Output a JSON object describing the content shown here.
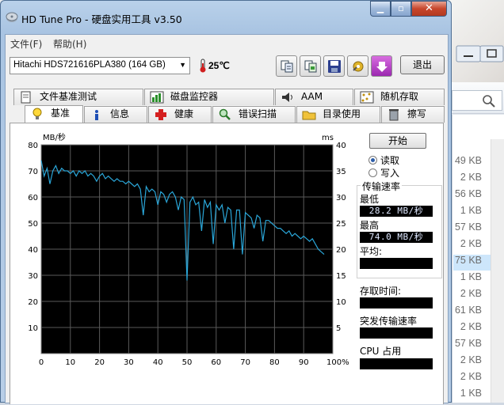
{
  "window": {
    "title": "HD Tune Pro - 硬盘实用工具 v3.50",
    "caption_buttons": [
      "minimize-icon",
      "maximize-icon",
      "close-icon"
    ]
  },
  "menu": {
    "file": "文件(F)",
    "help": "帮助(H)"
  },
  "toolbar": {
    "drive": "Hitachi HDS721616PLA380 (164 GB)",
    "temperature": "25℃",
    "exit_label": "退出",
    "icons": [
      "copy-text-icon",
      "copy-screenshot-icon",
      "save-icon",
      "options-icon",
      "download-icon"
    ]
  },
  "tabs_top": [
    "文件基准测试",
    "磁盘监控器",
    "AAM",
    "随机存取"
  ],
  "tabs_bottom": [
    "基准",
    "信息",
    "健康",
    "错误扫描",
    "目录使用",
    "擦写"
  ],
  "controls": {
    "start_label": "开始",
    "read_label": "读取",
    "write_label": "写入",
    "read_selected": true
  },
  "results": {
    "transfer_rate_title": "传输速率",
    "min_label": "最低",
    "min_value": "28.2 MB/秒",
    "max_label": "最高",
    "max_value": "74.0 MB/秒",
    "avg_label": "平均:",
    "avg_value": "",
    "access_label": "存取时间:",
    "access_value": "",
    "burst_label": "突发传输速率",
    "burst_value": "",
    "cpu_label": "CPU 占用",
    "cpu_value": ""
  },
  "background": {
    "file_sizes": [
      "49 KB",
      "2 KB",
      "56 KB",
      "1 KB",
      "57 KB",
      "2 KB",
      "75 KB",
      "1 KB",
      "2 KB",
      "61 KB",
      "2 KB",
      "57 KB",
      "2 KB",
      "2 KB",
      "1 KB"
    ],
    "selected_index": 6
  },
  "chart_data": {
    "type": "line",
    "y_left_unit": "MB/秒",
    "y_right_unit": "ms",
    "ylim_left": [
      0,
      80
    ],
    "ylim_right": [
      0,
      40
    ],
    "xlim": [
      0,
      100
    ],
    "x_ticks": [
      "0",
      "10",
      "20",
      "30",
      "40",
      "50",
      "60",
      "70",
      "80",
      "90",
      "100%"
    ],
    "y_left_ticks": [
      "10",
      "20",
      "30",
      "40",
      "50",
      "60",
      "70",
      "80"
    ],
    "y_right_ticks": [
      "5",
      "10",
      "15",
      "20",
      "25",
      "30",
      "35",
      "40"
    ],
    "grid": true,
    "series": [
      {
        "color": "#2aa6d8",
        "x": [
          0,
          1,
          2,
          3,
          4,
          5,
          6,
          7,
          8,
          9,
          10,
          11,
          12,
          13,
          14,
          15,
          16,
          17,
          18,
          19,
          20,
          21,
          22,
          23,
          24,
          25,
          26,
          27,
          28,
          29,
          30,
          31,
          32,
          33,
          34,
          35,
          36,
          37,
          38,
          39,
          40,
          41,
          42,
          43,
          44,
          45,
          46,
          47,
          48,
          49,
          50,
          51,
          52,
          53,
          54,
          55,
          56,
          57,
          58,
          59,
          60,
          61,
          62,
          63,
          64,
          65,
          66,
          67,
          68,
          69,
          70,
          71,
          72,
          73,
          74,
          75,
          76,
          77,
          78,
          79,
          80,
          81,
          82,
          83,
          84,
          85,
          86,
          87,
          88,
          89,
          90,
          91,
          92,
          93,
          94,
          95,
          96,
          97
        ],
        "y": [
          74,
          68,
          71,
          65,
          70,
          72,
          69,
          71,
          70,
          70,
          69,
          70,
          68,
          70,
          69,
          70,
          68,
          69,
          68,
          66,
          68,
          69,
          67,
          68,
          67,
          66,
          67,
          66,
          66,
          65,
          66,
          65,
          64,
          65,
          63,
          53,
          64,
          62,
          63,
          62,
          57,
          62,
          61,
          58,
          61,
          62,
          60,
          55,
          60,
          59,
          28,
          58,
          60,
          57,
          58,
          47,
          59,
          56,
          58,
          42,
          57,
          55,
          57,
          50,
          56,
          55,
          40,
          55,
          55,
          38,
          54,
          53,
          52,
          48,
          53,
          52,
          43,
          51,
          51,
          50,
          49,
          48,
          48,
          47,
          46,
          47,
          45,
          46,
          45,
          44,
          45,
          44,
          43,
          44,
          42,
          40,
          39,
          38
        ]
      }
    ]
  }
}
